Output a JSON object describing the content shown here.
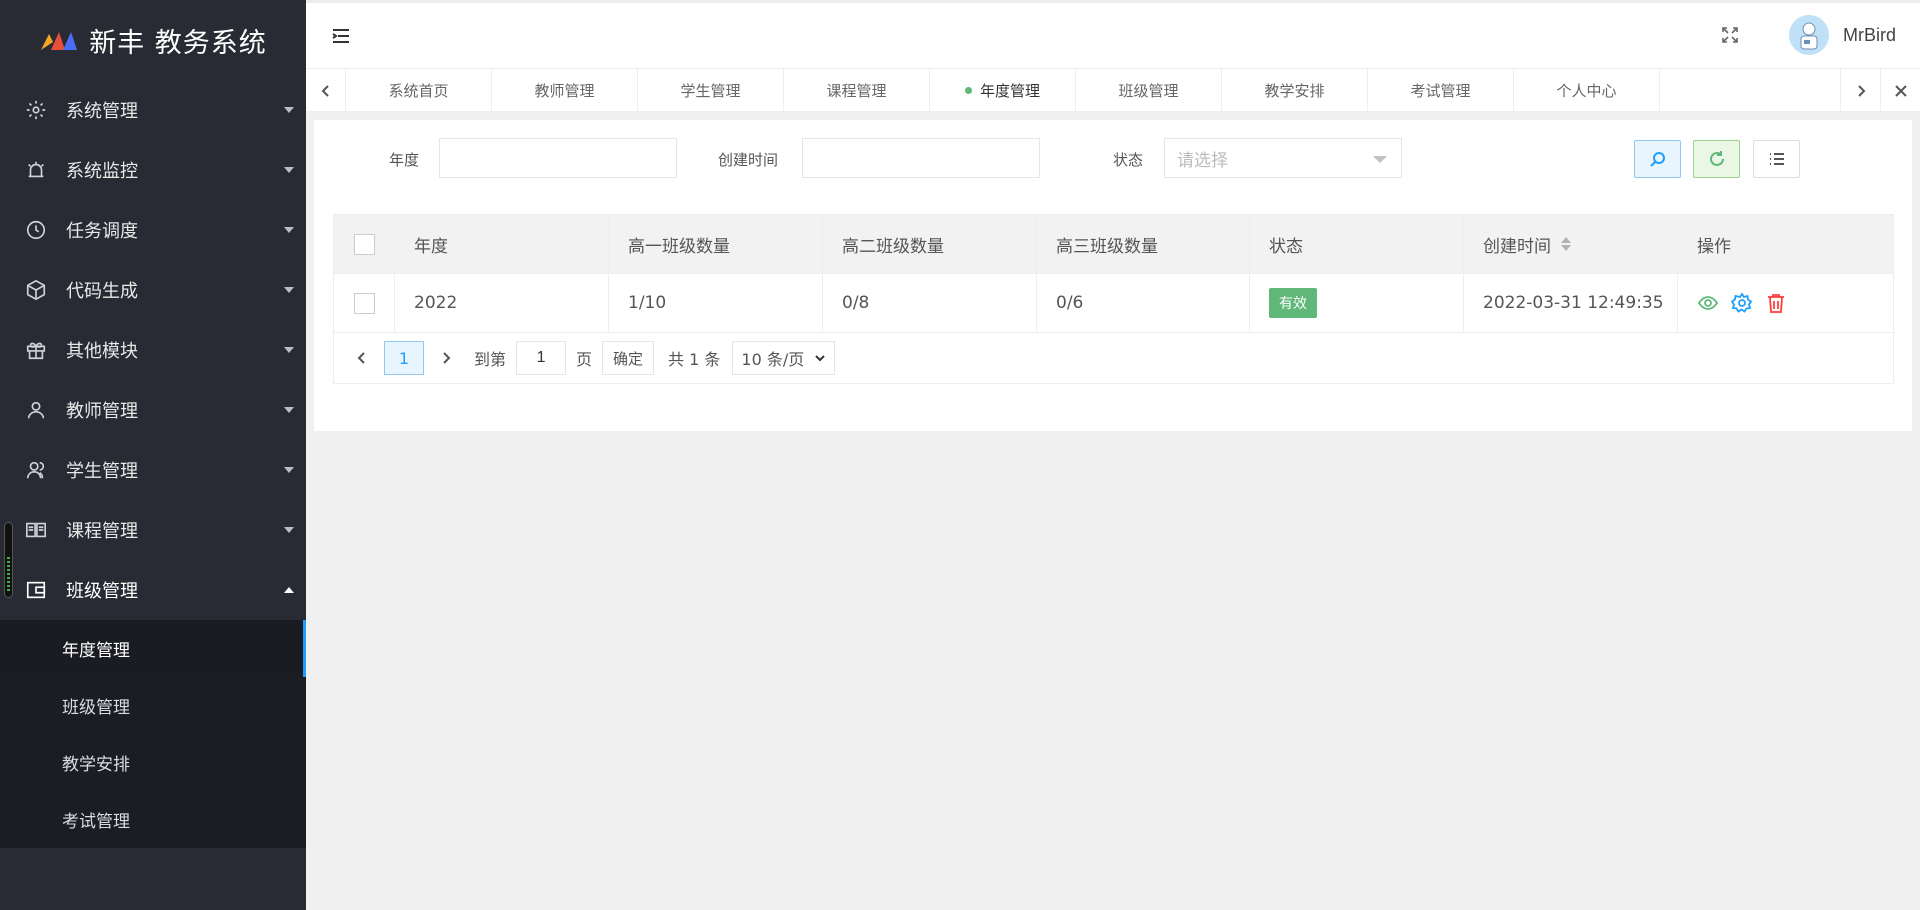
{
  "app": {
    "brand": "新丰 教务系统",
    "brand_colors": [
      "#f5a623",
      "#e94e3c",
      "#4a6cf7"
    ]
  },
  "sidebar": {
    "items": [
      {
        "label": "系统管理",
        "icon": "gear-icon"
      },
      {
        "label": "系统监控",
        "icon": "alarm-icon"
      },
      {
        "label": "任务调度",
        "icon": "clock-icon"
      },
      {
        "label": "代码生成",
        "icon": "cube-icon"
      },
      {
        "label": "其他模块",
        "icon": "gift-icon"
      },
      {
        "label": "教师管理",
        "icon": "user-icon"
      },
      {
        "label": "学生管理",
        "icon": "users-icon"
      },
      {
        "label": "课程管理",
        "icon": "book-icon"
      },
      {
        "label": "班级管理",
        "icon": "wallet-icon"
      }
    ],
    "submenu": [
      {
        "label": "年度管理",
        "active": true
      },
      {
        "label": "班级管理"
      },
      {
        "label": "教学安排"
      },
      {
        "label": "考试管理"
      }
    ]
  },
  "header": {
    "user_name": "MrBird"
  },
  "tabs": [
    {
      "label": "系统首页"
    },
    {
      "label": "教师管理"
    },
    {
      "label": "学生管理"
    },
    {
      "label": "课程管理"
    },
    {
      "label": "年度管理",
      "active": true
    },
    {
      "label": "班级管理"
    },
    {
      "label": "教学安排"
    },
    {
      "label": "考试管理"
    },
    {
      "label": "个人中心"
    }
  ],
  "search": {
    "year_label": "年度",
    "year_value": "",
    "created_label": "创建时间",
    "created_value": "",
    "status_label": "状态",
    "status_placeholder": "请选择"
  },
  "table": {
    "headers": [
      "年度",
      "高一班级数量",
      "高二班级数量",
      "高三班级数量",
      "状态",
      "创建时间",
      "操作"
    ],
    "rows": [
      {
        "year": "2022",
        "g1": "1/10",
        "g2": "0/8",
        "g3": "0/6",
        "status": "有效",
        "created": "2022-03-31 12:49:35"
      }
    ]
  },
  "pagination": {
    "current": "1",
    "goto_label": "到第",
    "goto_value": "1",
    "page_unit": "页",
    "confirm": "确定",
    "total": "共 1 条",
    "page_size": "10 条/页"
  },
  "colors": {
    "sidebar_bg": "#282b33",
    "active_indicator": "#1e9fff",
    "success": "#5fb878",
    "danger": "#ff5722"
  }
}
